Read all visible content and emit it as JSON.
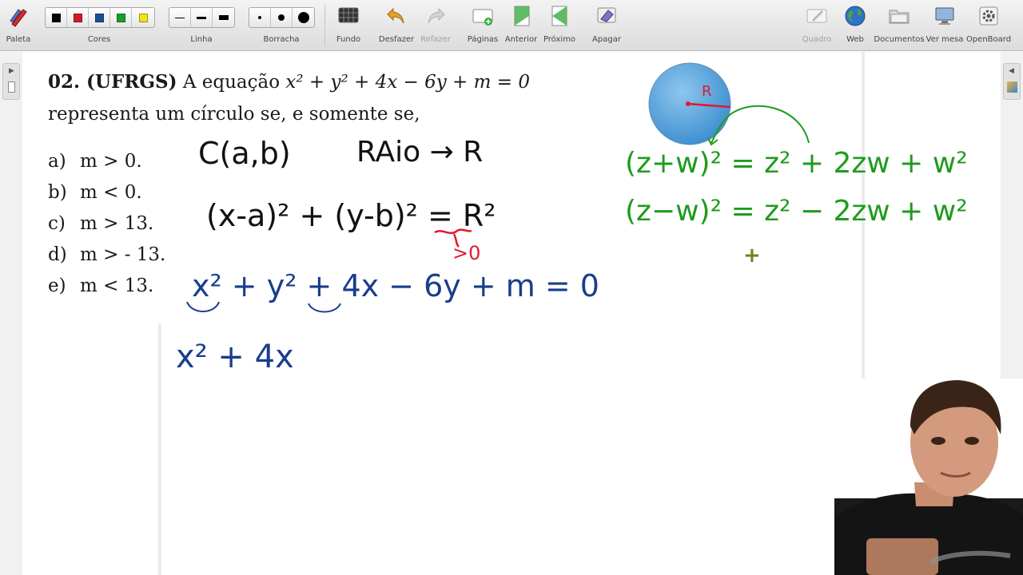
{
  "toolbar": {
    "paleta": "Paleta",
    "cores": "Cores",
    "linha": "Linha",
    "borracha": "Borracha",
    "fundo": "Fundo",
    "desfazer": "Desfazer",
    "refazer": "Refazer",
    "paginas": "Páginas",
    "anterior": "Anterior",
    "proximo": "Próximo",
    "apagar": "Apagar",
    "quadro": "Quadro",
    "web": "Web",
    "documentos": "Documentos",
    "ver_mesa": "Ver mesa",
    "openboard": "OpenBoard",
    "colors": [
      "#000000",
      "#d8172b",
      "#1d4f99",
      "#16a12a",
      "#f2e21a"
    ]
  },
  "question": {
    "number": "02. (UFRGS)",
    "stem_prefix": "A equação",
    "equation": "x² + y² + 4x − 6y + m = 0",
    "line2": "representa um círculo se, e somente se,",
    "options": [
      {
        "letter": "a)",
        "text": "m > 0."
      },
      {
        "letter": "b)",
        "text": "m < 0."
      },
      {
        "letter": "c)",
        "text": "m > 13."
      },
      {
        "letter": "d)",
        "text": "m > - 13."
      },
      {
        "letter": "e)",
        "text": "m < 13."
      }
    ]
  },
  "handwriting": {
    "center": "C(a,b)",
    "raio": "RAio → R",
    "circle_eq_left": "(x-a)² + (y-b)² = ",
    "circle_eq_R": "R²",
    "gt_zero": ">0",
    "given_eq": "x² + y² + 4x − 6y + m = 0",
    "partial": "x² + 4x",
    "circle_label": "R",
    "identity1": "(z+w)² = z² + 2zw + w²",
    "identity2": "(z−w)² = z² − 2zw + w²",
    "plus": "+"
  }
}
